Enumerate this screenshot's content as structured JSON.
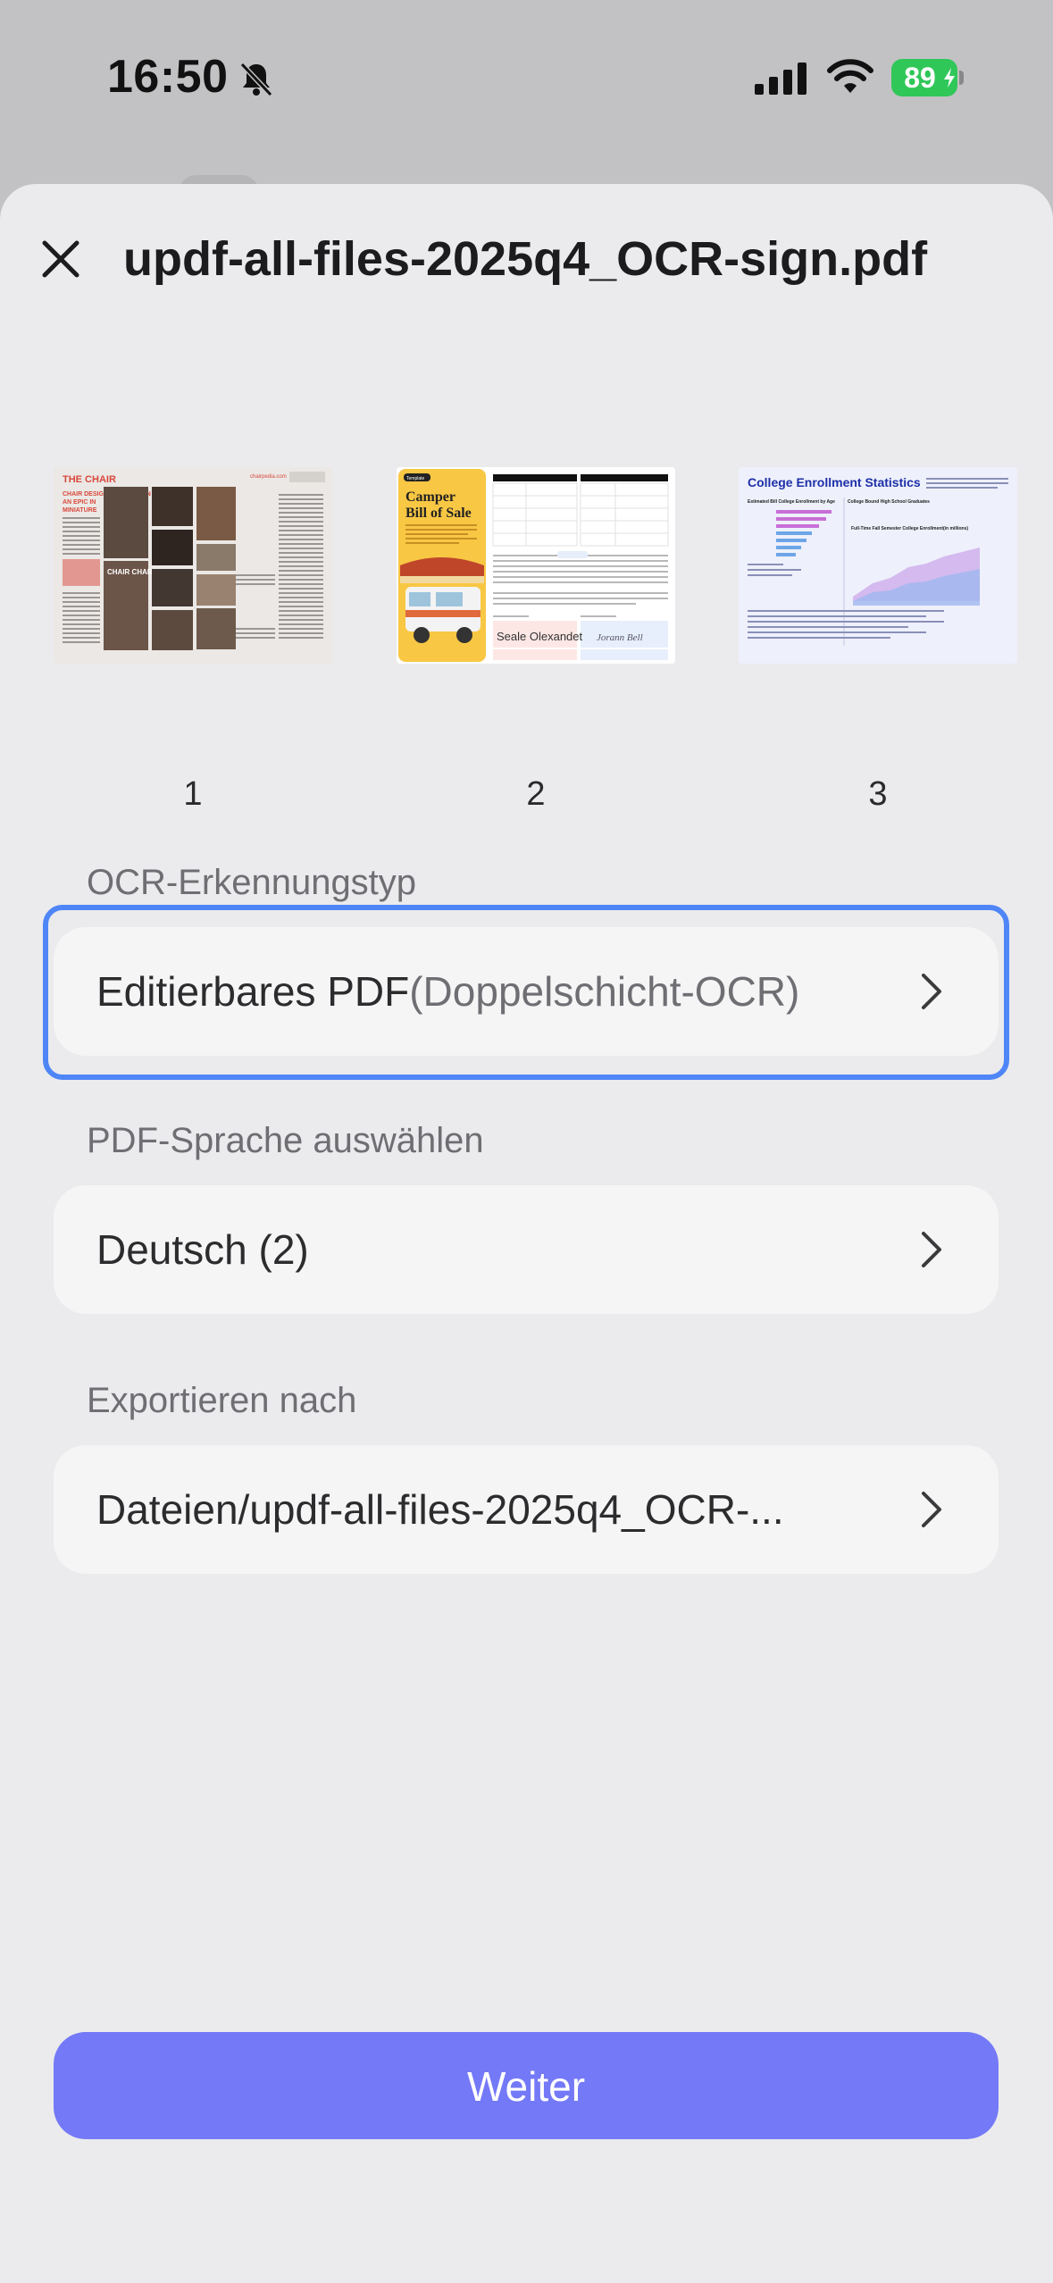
{
  "status_bar": {
    "time": "16:50",
    "battery": "89",
    "icons": [
      "bell-slash-icon",
      "cellular-signal-icon",
      "wifi-icon",
      "battery-charging-icon"
    ]
  },
  "header": {
    "title": "updf-all-files-2025q4_OCR-sign.pdf",
    "close_icon": "close-icon"
  },
  "pages": [
    {
      "number": "1",
      "preview": {
        "brand": "THE CHAIR",
        "site": "chairpedia.com",
        "headline": "CHAIR DESIGN REVOLUTION AN EPIC IN MINIATURE",
        "badge": "CHAIR CHARM"
      }
    },
    {
      "number": "2",
      "preview": {
        "tag": "Template",
        "title_line1": "Camper",
        "title_line2": "Bill of Sale",
        "signature_left": "Seale Olexandet",
        "signature_right": "Jorann Bell"
      }
    },
    {
      "number": "3",
      "preview": {
        "title": "College Enrollment Statistics",
        "left_heading": "Estimated Bill College Enrollment by Age",
        "right_heading": "College Bound High School Graduates",
        "chart_heading": "Full-Time Fall Semester College Enrollment(in millions)"
      }
    }
  ],
  "ocr_type": {
    "label": "OCR-Erkennungstyp",
    "value": "Editierbares PDF",
    "value_detail": "(Doppelschicht-OCR)"
  },
  "language": {
    "label": "PDF-Sprache auswählen",
    "value": "Deutsch (2)"
  },
  "export": {
    "label": "Exportieren nach",
    "value": "Dateien/updf-all-files-2025q4_OCR-..."
  },
  "continue_button": "Weiter",
  "colors": {
    "accent": "#7479f7",
    "selection": "#4f86f7",
    "battery": "#30c759"
  }
}
